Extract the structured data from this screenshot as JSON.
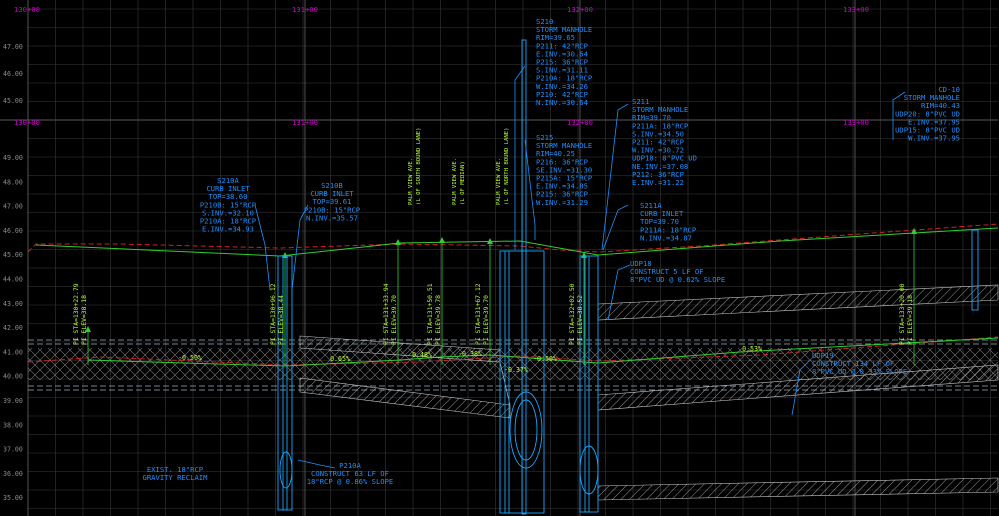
{
  "colors": {
    "background": "#000000",
    "grid": "#3a3a3a",
    "grid_major": "#5a5a5a",
    "station": "#d000d0",
    "elev": "#8c8c8c",
    "pipe": "#17a7ff",
    "annotation": "#1e90ff",
    "label_green": "#b8ff3a",
    "finished_grade": "#2fcf2f",
    "existing_grade": "#d02020",
    "white": "#d8d8d8"
  },
  "stations_top": [
    "130+00",
    "131+00",
    "132+00",
    "133+00"
  ],
  "stations_mid": [
    "130+00",
    "131+00",
    "132+00",
    "133+00"
  ],
  "elev_upper": [
    "47.00",
    "46.00",
    "45.00"
  ],
  "elev_lower": [
    "49.00",
    "48.00",
    "47.00",
    "46.00",
    "45.00",
    "44.00",
    "43.00",
    "42.00",
    "41.00",
    "40.00",
    "39.00",
    "38.00",
    "37.00",
    "36.00",
    "35.00"
  ],
  "structures": {
    "s210a": [
      "S210A",
      "CURB INLET",
      "TOP=38.60",
      "P210B: 15\"RCP",
      "S.INV.=32.10",
      "P210A: 18\"RCP",
      "E.INV.=34.93"
    ],
    "s210b": [
      "S210B",
      "CURB INLET",
      "TOP=39.61",
      "P210B: 15\"RCP",
      "N.INV.=35.57"
    ],
    "s210": [
      "S210",
      "STORM MANHOLE",
      "RIM=39.65",
      "P211: 42\"RCP",
      "E.INV.=30.64",
      "P215: 36\"RCP",
      "S.INV.=31.11",
      "P210A: 18\"RCP",
      "W.INV.=34.26",
      "P210: 42\"RCP",
      "N.INV.=30.64"
    ],
    "s215": [
      "S215",
      "STORM MANHOLE",
      "RIM=40.25",
      "P216: 36\"RCP",
      "SE.INV.=31.30",
      "P215A: 15\"RCP",
      "E.INV.=34.85",
      "P215: 36\"RCP",
      "W.INV.=31.29"
    ],
    "s211": [
      "S211",
      "STORM MANHOLE",
      "RIM=39.70",
      "P211A: 18\"RCP",
      "S.INV.=34.50",
      "P211: 42\"RCP",
      "W.INV.=30.72",
      "UDP18: 8\"PVC UD",
      "NE.INV.=37.08",
      "P212: 36\"RCP",
      "E.INV.=31.22"
    ],
    "s211a": [
      "S211A",
      "CURB INLET",
      "TOP=39.70",
      "P211A: 18\"RCP",
      "N.INV.=34.87"
    ],
    "cd10": [
      "CD-10",
      "STORM MANHOLE",
      "RIM=40.43",
      "UDP20: 8\"PVC UD",
      "E.INV.=37.95",
      "UDP15: 8\"PVC UD",
      "W.INV.=37.95"
    ]
  },
  "pipe_notes": {
    "udp18": [
      "UDP18",
      "CONSTRUCT 5 LF OF",
      "8\"PVC UD @ 0.62% SLOPE"
    ],
    "udp19": [
      "UDP19",
      "CONSTRUCT 134 LF OF",
      "8\"PVC UD @ 0.33% SLOPE"
    ],
    "p210a": [
      "P210A",
      "CONSTRUCT 63 LF OF",
      "18\"RCP @ 0.86% SLOPE"
    ],
    "exist": [
      "EXIST. 18\"RCP",
      "GRAVITY RECLAIM"
    ]
  },
  "road_labels": [
    "PALM VIEW AVE.",
    "(L OF SOUTH BOUND LANE)",
    "PALM VIEW AVE.",
    "(L OF MEDIAN)",
    "PALM VIEW AVE.",
    "(L OF NORTH BOUND LANE)"
  ],
  "pi_labels": [
    {
      "sta": "PI  STA=130+22.79",
      "elev": "PI  ELEV=38.18"
    },
    {
      "sta": "PI  STA=130+96.12",
      "elev": "PI  ELEV=38.44"
    },
    {
      "sta": "PI  STA=131+33.94",
      "elev": "PI  ELEV=39.70"
    },
    {
      "sta": "PI  STA=131+50.51",
      "elev": "PI  ELEV=39.78"
    },
    {
      "sta": "PI  STA=131+67.12",
      "elev": "PI  ELEV=39.70"
    },
    {
      "sta": "PI  STA=132+02.50",
      "elev": "PI  ELEV=38.52"
    },
    {
      "sta": "PI  STA=133+20.00",
      "elev": "PI  ELEV=39.18"
    }
  ],
  "slope_labels": [
    "-0.50%",
    "0.65%",
    "0.48%",
    "-0.38%",
    "-0.50%",
    "0.53%",
    "-0.37%"
  ]
}
